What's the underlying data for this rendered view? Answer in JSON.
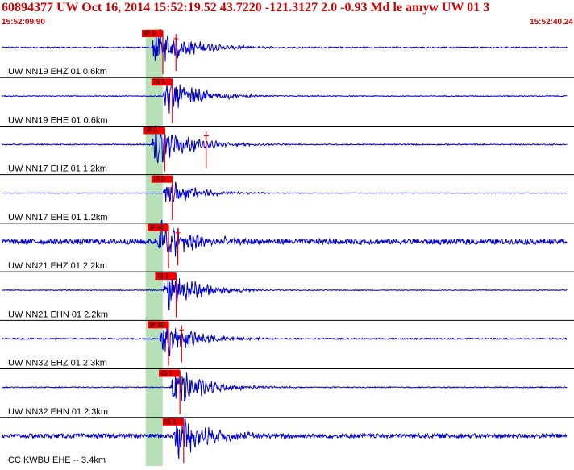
{
  "event": {
    "title": "60894377 UW Oct 16, 2014 15:52:19.52   43.7220 -121.3127  2.0 -0.93 Md le amyw UW 01   3",
    "start_time": "15:52:09.90",
    "end_time": "15:52:40.24"
  },
  "colors": {
    "header_text": "#cc0000",
    "trace": "#0000cc",
    "pick": "#ee0000",
    "window_highlight": "#b6e0b6",
    "divider": "#000000"
  },
  "traces": [
    {
      "label": "UW NN19 EHZ 01 0.6km",
      "pick": "iP 0",
      "p_sec": 8.0,
      "pick_sec": 7.5,
      "amp": 1.0,
      "noise": 0.06,
      "extra_pick_sec": 9.3
    },
    {
      "label": "UW NN19 EHE 01 0.6km",
      "pick": "iS 1",
      "p_sec": 8.6,
      "pick_sec": 8.0,
      "amp": 0.8,
      "noise": 0.05
    },
    {
      "label": "UW NN17 EHZ 01 1.2km",
      "pick": "iP 0",
      "p_sec": 8.0,
      "pick_sec": 7.6,
      "amp": 1.0,
      "noise": 0.05,
      "extra_pick_sec": 10.9
    },
    {
      "label": "UW NN17 EHE 01 1.2km",
      "pick": "iS 0",
      "p_sec": 8.6,
      "pick_sec": 8.0,
      "amp": 0.55,
      "noise": 0.05
    },
    {
      "label": "UW NN21 EHZ 01 2.2km",
      "pick": "iP d0",
      "p_sec": 8.3,
      "pick_sec": 7.8,
      "amp": 1.0,
      "noise": 0.25,
      "extra_pick_sec": 9.4
    },
    {
      "label": "UW NN21 EHN 01 2.2km",
      "pick": "iS 1",
      "p_sec": 8.6,
      "pick_sec": 8.2,
      "amp": 0.9,
      "noise": 0.04
    },
    {
      "label": "UW NN32 EHZ 01 2.3km",
      "pick": "iP d0",
      "p_sec": 8.4,
      "pick_sec": 7.8,
      "amp": 0.85,
      "noise": 0.07,
      "extra_pick_sec": 9.6
    },
    {
      "label": "UW NN32 EHN 01 2.3km",
      "pick": "iS 1",
      "p_sec": 9.0,
      "pick_sec": 8.4,
      "amp": 0.9,
      "noise": 0.05
    },
    {
      "label": "CC KWBU EHE -- 3.4km",
      "pick": "iS 1",
      "p_sec": 9.1,
      "pick_sec": 8.6,
      "amp": 1.0,
      "noise": 0.2
    }
  ],
  "window": {
    "start_sec": 7.7,
    "end_sec": 8.6
  }
}
